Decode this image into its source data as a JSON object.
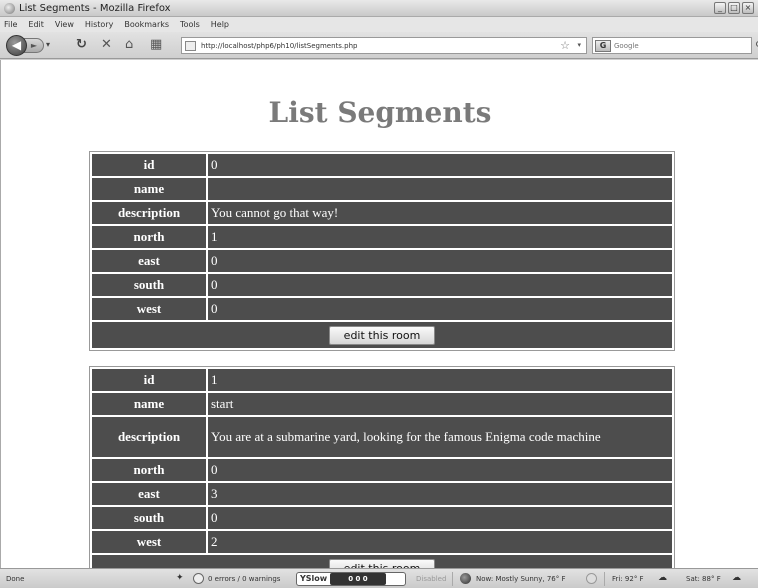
{
  "window": {
    "title": "List Segments - Mozilla Firefox",
    "controls": [
      "_",
      "□",
      "×"
    ]
  },
  "menu": [
    "File",
    "Edit",
    "View",
    "History",
    "Bookmarks",
    "Tools",
    "Help"
  ],
  "nav": {
    "url": "http://localhost/php6/ph10/listSegments.php",
    "search_placeholder": "Google"
  },
  "page": {
    "heading": "List Segments",
    "labels": {
      "id": "id",
      "name": "name",
      "description": "description",
      "north": "north",
      "east": "east",
      "south": "south",
      "west": "west"
    },
    "edit_button": "edit this room",
    "segments": [
      {
        "id": "0",
        "name": "",
        "description": "You cannot go that way!",
        "north": "1",
        "east": "0",
        "south": "0",
        "west": "0"
      },
      {
        "id": "1",
        "name": "start",
        "description": "You are at a submarine yard, looking for the famous Enigma code machine",
        "north": "0",
        "east": "3",
        "south": "0",
        "west": "2"
      }
    ]
  },
  "status": {
    "text": "Done",
    "errors": "0 errors / 0 warnings",
    "yslow_label": "YSlow",
    "yslow_grade": "0   0   0",
    "disabled": "Disabled",
    "weather_now": "Now: Mostly Sunny, 76° F",
    "weather_fri": "Fri: 92° F",
    "weather_sat": "Sat: 88° F"
  }
}
